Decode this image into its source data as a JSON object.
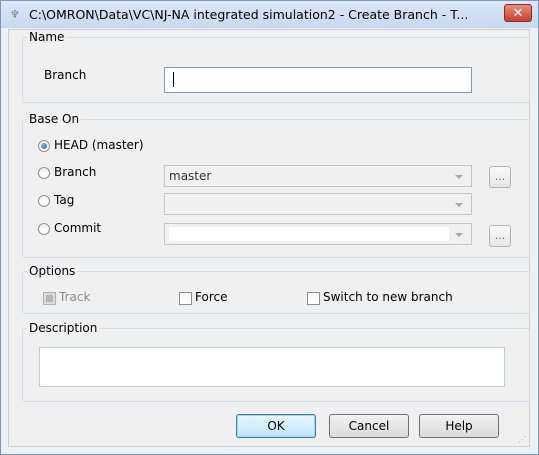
{
  "window": {
    "title": "C:\\OMRON\\Data\\VC\\NJ-NA integrated simulation2 - Create Branch - T...",
    "close_label": "✕",
    "app_icon": "tortoisegit-icon"
  },
  "name_group": {
    "legend": "Name",
    "branch_label": "Branch",
    "branch_value": ""
  },
  "base_on": {
    "legend": "Base On",
    "head_label": "HEAD (master)",
    "branch_label": "Branch",
    "branch_combo_value": "master",
    "tag_label": "Tag",
    "tag_combo_value": "",
    "commit_label": "Commit",
    "commit_combo_value": "",
    "ellipsis_label": "...",
    "selected": "HEAD (master)"
  },
  "options": {
    "legend": "Options",
    "track_label": "Track",
    "track_checked": false,
    "track_enabled": false,
    "force_label": "Force",
    "force_checked": false,
    "switch_label": "Switch to new branch",
    "switch_checked": false
  },
  "description": {
    "legend": "Description",
    "value": ""
  },
  "buttons": {
    "ok": "OK",
    "cancel": "Cancel",
    "help": "Help"
  }
}
